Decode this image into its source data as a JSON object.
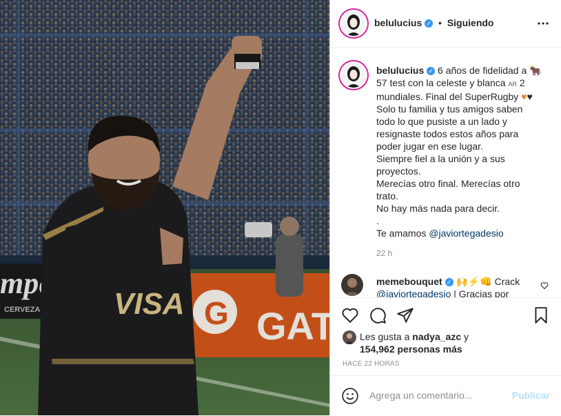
{
  "post": {
    "username": "belulucius",
    "follow_status": "Siguiendo",
    "more_icon": "more-horizontal-icon",
    "caption": {
      "username": "belulucius",
      "line1_text": "6 años de fidelidad a",
      "line2_text": "57 test con la celeste y blanca",
      "line2_flag": "AR",
      "line2_tail": "2",
      "line3_text": "mundiales. Final del SuperRugby",
      "line4": "Solo tu familia y tus amigos saben",
      "line5": "todo lo que pusiste a un lado y",
      "line6": "resignaste todos estos años para",
      "line7": "poder jugar en ese lugar.",
      "line8": "Siempre fiel a la unión y a sus",
      "line9": "proyectos.",
      "line10": "Merecías otro final. Merecías otro",
      "line11": "trato.",
      "line12": "No hay más nada para decir.",
      "line13": ".",
      "line14_text": "Te amamos",
      "line14_mention": "@javiortegadesio"
    },
    "caption_time": "22 h",
    "comment": {
      "username": "memebouquet",
      "text_tail": "Crack",
      "mention": "@javiortegadesio",
      "text2": "| Gracias por"
    },
    "likes": {
      "prefix": "Les gusta a",
      "liker": "nadya_azc",
      "suffix": "y",
      "count_text": "154,962 personas más"
    },
    "timestamp": "HACE 22 HORAS",
    "comment_placeholder": "Agrega un comentario...",
    "publish_label": "Publicar"
  },
  "photo": {
    "jersey_text": "VISA",
    "sponsor_text": "G GAT",
    "banner_text": "mper",
    "banner_sub": "CERVEZA"
  },
  "colors": {
    "accent": "#0095f6",
    "publish_disabled": "#b2dffc",
    "link": "#00376b",
    "verified": "#3897f0"
  }
}
